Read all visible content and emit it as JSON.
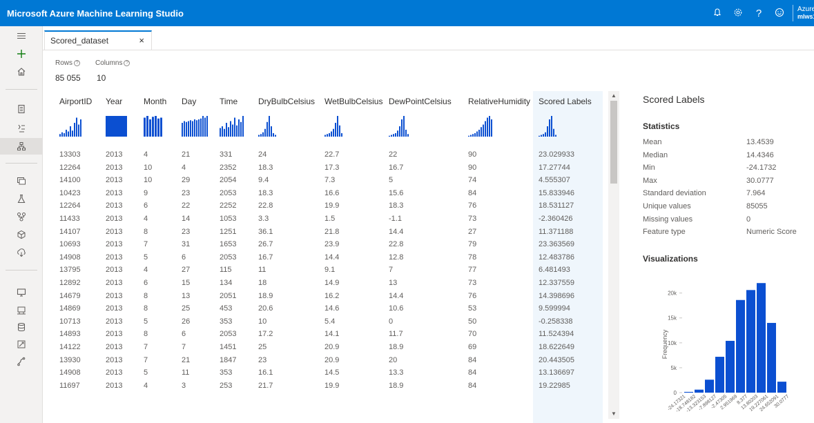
{
  "app": {
    "title": "Microsoft Azure Machine Learning Studio",
    "account_line1": "Azure",
    "account_line2": "mlws1"
  },
  "tab": {
    "label": "Scored_dataset",
    "close": "×"
  },
  "meta": {
    "rows_label": "Rows",
    "rows_value": "85 055",
    "columns_label": "Columns",
    "columns_value": "10",
    "help": "?"
  },
  "table": {
    "columns": [
      "AirportID",
      "Year",
      "Month",
      "Day",
      "Time",
      "DryBulbCelsius",
      "WetBulbCelsius",
      "DewPointCelsius",
      "RelativeHumidity",
      "Scored Labels"
    ],
    "selected_column": 9,
    "rows": [
      [
        "13303",
        "2013",
        "4",
        "21",
        "331",
        "24",
        "22.7",
        "22",
        "90",
        "23.029933"
      ],
      [
        "12264",
        "2013",
        "10",
        "4",
        "2352",
        "18.3",
        "17.3",
        "16.7",
        "90",
        "17.27744"
      ],
      [
        "14100",
        "2013",
        "10",
        "29",
        "2054",
        "9.4",
        "7.3",
        "5",
        "74",
        "4.555307"
      ],
      [
        "10423",
        "2013",
        "9",
        "23",
        "2053",
        "18.3",
        "16.6",
        "15.6",
        "84",
        "15.833946"
      ],
      [
        "12264",
        "2013",
        "6",
        "22",
        "2252",
        "22.8",
        "19.9",
        "18.3",
        "76",
        "18.531127"
      ],
      [
        "11433",
        "2013",
        "4",
        "14",
        "1053",
        "3.3",
        "1.5",
        "-1.1",
        "73",
        "-2.360426"
      ],
      [
        "14107",
        "2013",
        "8",
        "23",
        "1251",
        "36.1",
        "21.8",
        "14.4",
        "27",
        "11.371188"
      ],
      [
        "10693",
        "2013",
        "7",
        "31",
        "1653",
        "26.7",
        "23.9",
        "22.8",
        "79",
        "23.363569"
      ],
      [
        "14908",
        "2013",
        "5",
        "6",
        "2053",
        "16.7",
        "14.4",
        "12.8",
        "78",
        "12.483786"
      ],
      [
        "13795",
        "2013",
        "4",
        "27",
        "115",
        "11",
        "9.1",
        "7",
        "77",
        "6.481493"
      ],
      [
        "12892",
        "2013",
        "6",
        "15",
        "134",
        "18",
        "14.9",
        "13",
        "73",
        "12.337559"
      ],
      [
        "14679",
        "2013",
        "8",
        "13",
        "2051",
        "18.9",
        "16.2",
        "14.4",
        "76",
        "14.398696"
      ],
      [
        "14869",
        "2013",
        "8",
        "25",
        "453",
        "20.6",
        "14.6",
        "10.6",
        "53",
        "9.599994"
      ],
      [
        "10713",
        "2013",
        "5",
        "26",
        "353",
        "10",
        "5.4",
        "0",
        "50",
        "-0.258338"
      ],
      [
        "14893",
        "2013",
        "8",
        "6",
        "2053",
        "17.2",
        "14.1",
        "11.7",
        "70",
        "11.524394"
      ],
      [
        "14122",
        "2013",
        "7",
        "7",
        "1451",
        "25",
        "20.9",
        "18.9",
        "69",
        "18.622649"
      ],
      [
        "13930",
        "2013",
        "7",
        "21",
        "1847",
        "23",
        "20.9",
        "20",
        "84",
        "20.443505"
      ],
      [
        "14908",
        "2013",
        "5",
        "11",
        "353",
        "16.1",
        "14.5",
        "13.3",
        "84",
        "13.136697"
      ],
      [
        "11697",
        "2013",
        "4",
        "3",
        "253",
        "21.7",
        "19.9",
        "18.9",
        "84",
        "19.22985"
      ]
    ]
  },
  "panel": {
    "title": "Scored Labels",
    "statistics_heading": "Statistics",
    "stats": [
      [
        "Mean",
        "13.4539"
      ],
      [
        "Median",
        "14.4346"
      ],
      [
        "Min",
        "-24.1732"
      ],
      [
        "Max",
        "30.0777"
      ],
      [
        "Standard deviation",
        "7.964"
      ],
      [
        "Unique values",
        "85055"
      ],
      [
        "Missing values",
        "0"
      ],
      [
        "Feature type",
        "Numeric Score"
      ]
    ],
    "visualizations_heading": "Visualizations"
  },
  "icons": {
    "topbar": [
      "bell-icon",
      "settings-gear-icon",
      "help-icon",
      "feedback-smiley-icon"
    ],
    "sidebar": [
      "hamburger-menu-icon",
      "new-plus-icon",
      "home-icon",
      "notebooks-icon",
      "automl-icon",
      "designer-icon",
      "datasets-icon",
      "experiments-icon",
      "pipelines-icon",
      "models-icon",
      "endpoints-icon",
      "compute-icon",
      "datastores-icon",
      "datastores-list-icon",
      "labeling-icon",
      "linked-services-icon"
    ]
  },
  "colors": {
    "accent": "#0078d4",
    "bar": "#0b4fd1",
    "selected_col": "#eff6fc"
  },
  "chart_data": {
    "type": "bar",
    "ylabel": "Frequency",
    "yticks": [
      "0",
      "5k",
      "10k",
      "15k",
      "20k"
    ],
    "ylim": [
      0,
      23000
    ],
    "categories": [
      "-24.17321",
      "-18.74818",
      "-13.32315",
      "-7.898127",
      "-2.473099",
      "2.951929",
      "8.376956",
      "13.80198",
      "19.22701",
      "24.65204"
    ],
    "values": [
      150,
      600,
      2600,
      7200,
      10400,
      18600,
      20600,
      22000,
      14000,
      2200
    ],
    "xtick_labels": [
      "-24.17321",
      "-18.748182",
      "-13.323153",
      "-7.898127",
      "-2.47305",
      "2.951969",
      "8.377",
      "13.80203",
      "19.227061",
      "24.652091",
      "30.0777"
    ],
    "grid": false
  }
}
